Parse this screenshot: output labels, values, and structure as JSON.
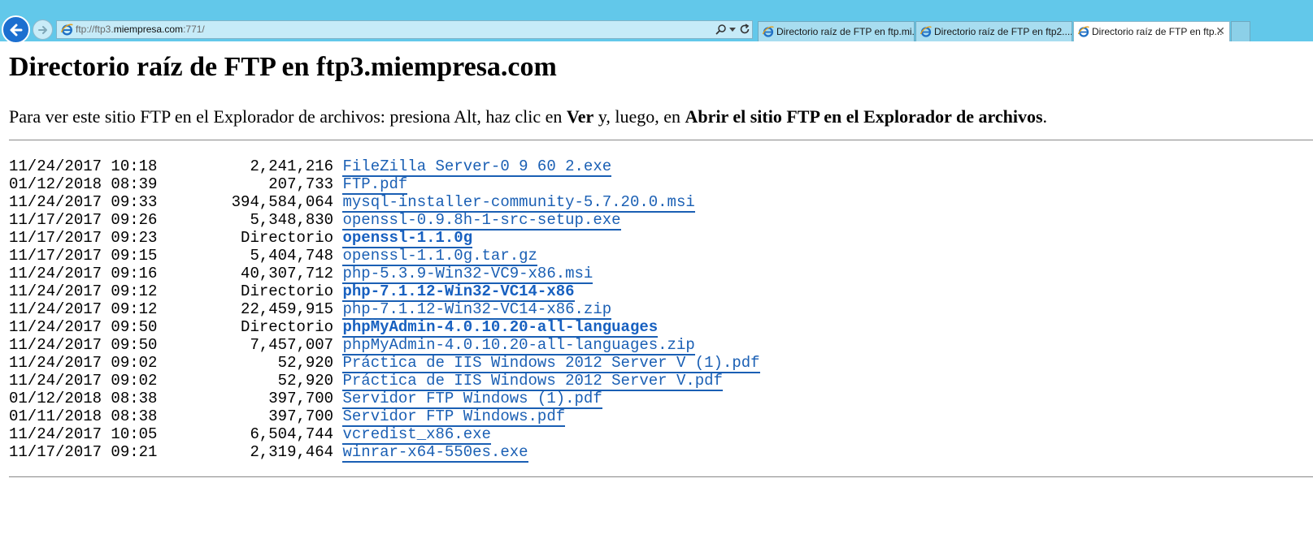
{
  "browser": {
    "address": {
      "prefix": "ftp://ftp3.",
      "host": "miempresa.com",
      "suffix": ":771/"
    },
    "tabs": [
      {
        "label": "Directorio raíz de FTP en ftp.mi...",
        "active": false
      },
      {
        "label": "Directorio raíz de FTP en ftp2....",
        "active": false
      },
      {
        "label": "Directorio raíz de FTP en ftp...",
        "active": true
      }
    ],
    "close_glyph": "✕"
  },
  "page": {
    "title": "Directorio raíz de FTP en ftp3.miempresa.com",
    "instructions": {
      "part1": "Para ver este sitio FTP en el Explorador de archivos: presiona Alt, haz clic en ",
      "bold1": "Ver",
      "part2": " y, luego, en ",
      "bold2": "Abrir el sitio FTP en el Explorador de archivos",
      "part3": "."
    }
  },
  "listing": [
    {
      "date": "11/24/2017",
      "time": "10:18",
      "size": "2,241,216",
      "name": "FileZilla Server-0 9 60 2.exe",
      "is_dir": false
    },
    {
      "date": "01/12/2018",
      "time": "08:39",
      "size": "207,733",
      "name": "FTP.pdf",
      "is_dir": false
    },
    {
      "date": "11/24/2017",
      "time": "09:33",
      "size": "394,584,064",
      "name": "mysql-installer-community-5.7.20.0.msi",
      "is_dir": false
    },
    {
      "date": "11/17/2017",
      "time": "09:26",
      "size": "5,348,830",
      "name": "openssl-0.9.8h-1-src-setup.exe",
      "is_dir": false
    },
    {
      "date": "11/17/2017",
      "time": "09:23",
      "size": "Directorio",
      "name": "openssl-1.1.0g",
      "is_dir": true
    },
    {
      "date": "11/17/2017",
      "time": "09:15",
      "size": "5,404,748",
      "name": "openssl-1.1.0g.tar.gz",
      "is_dir": false
    },
    {
      "date": "11/24/2017",
      "time": "09:16",
      "size": "40,307,712",
      "name": "php-5.3.9-Win32-VC9-x86.msi",
      "is_dir": false
    },
    {
      "date": "11/24/2017",
      "time": "09:12",
      "size": "Directorio",
      "name": "php-7.1.12-Win32-VC14-x86",
      "is_dir": true
    },
    {
      "date": "11/24/2017",
      "time": "09:12",
      "size": "22,459,915",
      "name": "php-7.1.12-Win32-VC14-x86.zip",
      "is_dir": false
    },
    {
      "date": "11/24/2017",
      "time": "09:50",
      "size": "Directorio",
      "name": "phpMyAdmin-4.0.10.20-all-languages",
      "is_dir": true
    },
    {
      "date": "11/24/2017",
      "time": "09:50",
      "size": "7,457,007",
      "name": "phpMyAdmin-4.0.10.20-all-languages.zip",
      "is_dir": false
    },
    {
      "date": "11/24/2017",
      "time": "09:02",
      "size": "52,920",
      "name": "Práctica de IIS Windows 2012 Server V (1).pdf",
      "is_dir": false
    },
    {
      "date": "11/24/2017",
      "time": "09:02",
      "size": "52,920",
      "name": "Práctica de IIS Windows 2012 Server V.pdf",
      "is_dir": false
    },
    {
      "date": "01/12/2018",
      "time": "08:38",
      "size": "397,700",
      "name": "Servidor FTP Windows (1).pdf",
      "is_dir": false
    },
    {
      "date": "01/11/2018",
      "time": "08:38",
      "size": "397,700",
      "name": "Servidor FTP Windows.pdf",
      "is_dir": false
    },
    {
      "date": "11/24/2017",
      "time": "10:05",
      "size": "6,504,744",
      "name": "vcredist_x86.exe",
      "is_dir": false
    },
    {
      "date": "11/17/2017",
      "time": "09:21",
      "size": "2,319,464",
      "name": "winrar-x64-550es.exe",
      "is_dir": false
    }
  ],
  "colors": {
    "chrome": "#62c8ea",
    "link": "#1a5fb4",
    "back_button": "#1b6fd0"
  }
}
